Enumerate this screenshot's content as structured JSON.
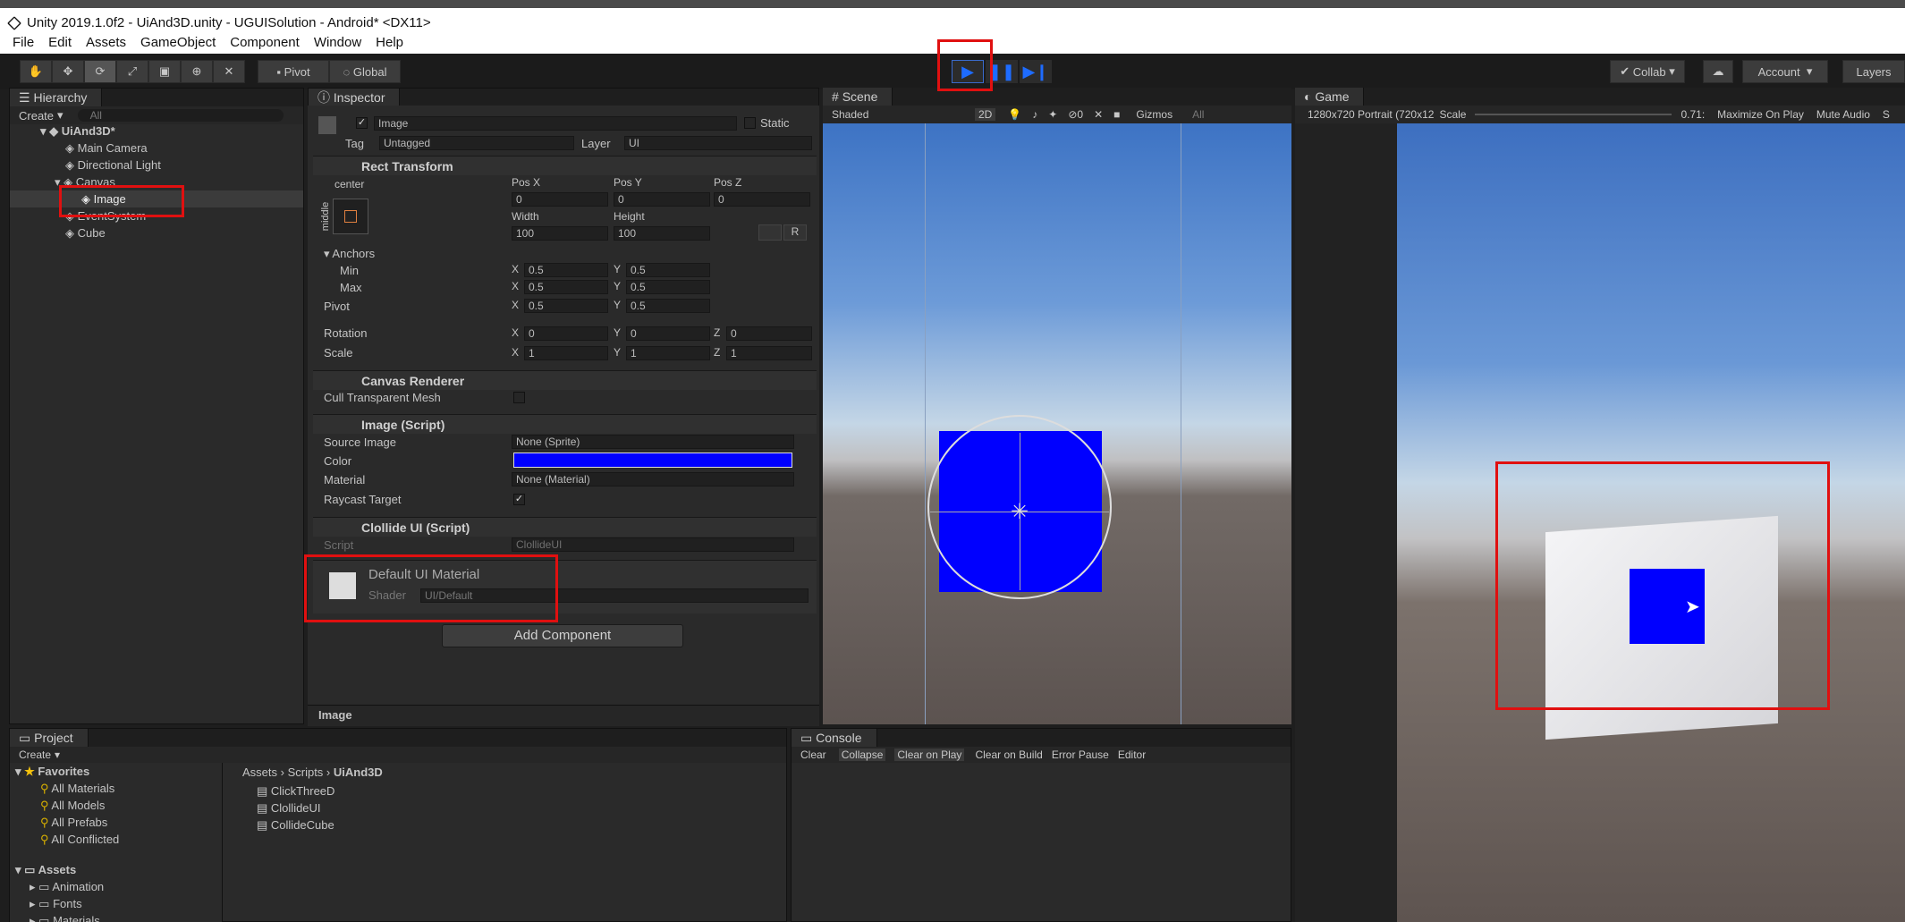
{
  "window": {
    "title": "Unity 2019.1.0f2 - UiAnd3D.unity - UGUISolution - Android* <DX11>"
  },
  "menu": [
    "File",
    "Edit",
    "Assets",
    "GameObject",
    "Component",
    "Window",
    "Help"
  ],
  "toolbar": {
    "pivot": "Pivot",
    "global": "Global",
    "collab": "Collab",
    "account": "Account",
    "layers": "Layers"
  },
  "hierarchy": {
    "tab": "Hierarchy",
    "create": "Create",
    "search_placeholder": "All",
    "scene": "UiAnd3D*",
    "items": [
      "Main Camera",
      "Directional Light",
      "Canvas",
      "Image",
      "EventSystem",
      "Cube"
    ]
  },
  "inspector": {
    "tab": "Inspector",
    "object_name": "Image",
    "static_label": "Static",
    "tag_label": "Tag",
    "tag_value": "Untagged",
    "layer_label": "Layer",
    "layer_value": "UI",
    "rect": {
      "title": "Rect Transform",
      "anchor_h": "center",
      "anchor_v": "middle",
      "posx_label": "Pos X",
      "posy_label": "Pos Y",
      "posz_label": "Pos Z",
      "posx": "0",
      "posy": "0",
      "posz": "0",
      "width_label": "Width",
      "height_label": "Height",
      "width": "100",
      "height": "100",
      "anchors": "Anchors",
      "min": "Min",
      "max": "Max",
      "min_x": "0.5",
      "min_y": "0.5",
      "max_x": "0.5",
      "max_y": "0.5",
      "pivot": "Pivot",
      "pivot_x": "0.5",
      "pivot_y": "0.5",
      "rotation": "Rotation",
      "rot_x": "0",
      "rot_y": "0",
      "rot_z": "0",
      "scale": "Scale",
      "scale_x": "1",
      "scale_y": "1",
      "scale_z": "1",
      "x": "X",
      "y": "Y",
      "z": "Z",
      "r": "R"
    },
    "canvas_renderer": {
      "title": "Canvas Renderer",
      "cull": "Cull Transparent Mesh"
    },
    "image_script": {
      "title": "Image (Script)",
      "source_label": "Source Image",
      "source": "None (Sprite)",
      "color_label": "Color",
      "material_label": "Material",
      "material": "None (Material)",
      "raycast": "Raycast Target",
      "color": "#0000ff"
    },
    "collide": {
      "title": "Clollide UI (Script)",
      "script_label": "Script",
      "script": "ClollideUI"
    },
    "material": {
      "name": "Default UI Material",
      "shader_label": "Shader",
      "shader": "UI/Default"
    },
    "add_component": "Add Component",
    "footer": "Image"
  },
  "scene": {
    "tab": "Scene",
    "shaded": "Shaded",
    "twoD": "2D",
    "gizmos": "Gizmos",
    "all": "All",
    "hidden": "0"
  },
  "game": {
    "tab": "Game",
    "resolution": "1280x720 Portrait (720x12",
    "scale_label": "Scale",
    "scale_value": "0.71:",
    "maximize": "Maximize On Play",
    "mute": "Mute Audio",
    "stats": "S"
  },
  "project": {
    "tab": "Project",
    "create": "Create",
    "favorites": "Favorites",
    "fav_items": [
      "All Materials",
      "All Models",
      "All Prefabs",
      "All Conflicted"
    ],
    "assets": "Assets",
    "asset_folders": [
      "Animation",
      "Fonts",
      "Materials"
    ],
    "breadcrumb": [
      "Assets",
      "Scripts",
      "UiAnd3D"
    ],
    "files": [
      "ClickThreeD",
      "ClollideUI",
      "CollideCube"
    ]
  },
  "console": {
    "tab": "Console",
    "buttons": [
      "Clear",
      "Collapse",
      "Clear on Play",
      "Clear on Build",
      "Error Pause",
      "Editor"
    ]
  }
}
